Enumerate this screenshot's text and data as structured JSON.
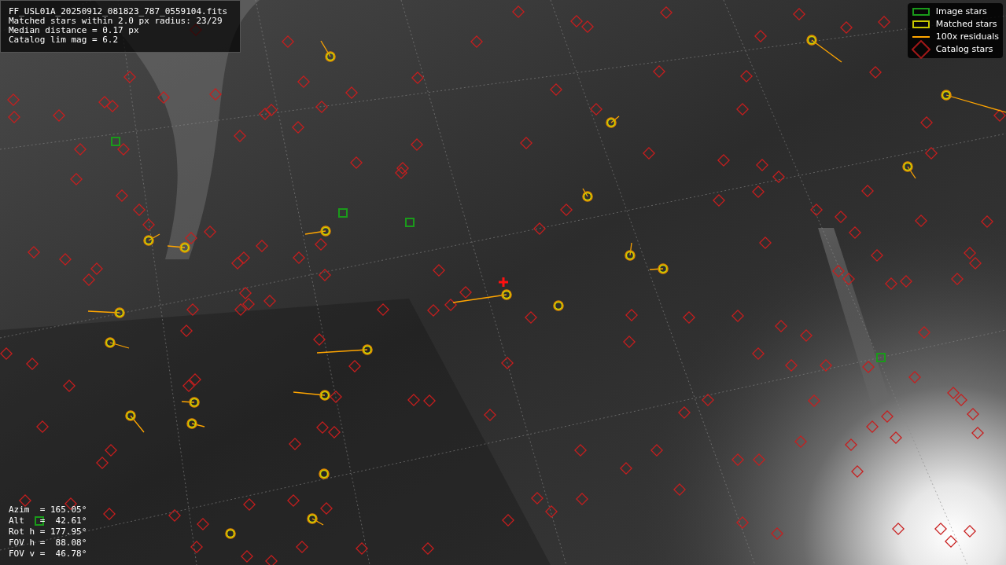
{
  "image_info": {
    "lines": [
      "FF_USL01A_20250912_081823_787_0559104.fits",
      "Matched stars within 2.0 px radius: 23/29",
      "Median distance = 0.17 px",
      "Catalog lim mag = 6.2"
    ]
  },
  "legend": {
    "items": [
      {
        "label": "Image stars"
      },
      {
        "kind": "matched",
        "label": "Matched stars"
      },
      {
        "kind": "residual",
        "label": "100x residuals"
      },
      {
        "kind": "catalog",
        "label": "Catalog stars"
      }
    ]
  },
  "pointing": {
    "lines": [
      "Azim  = 165.05°",
      "Alt   =  42.61°",
      "Rot h = 177.95°",
      "FOV h =  88.08°",
      "FOV v =  46.78°"
    ]
  }
}
